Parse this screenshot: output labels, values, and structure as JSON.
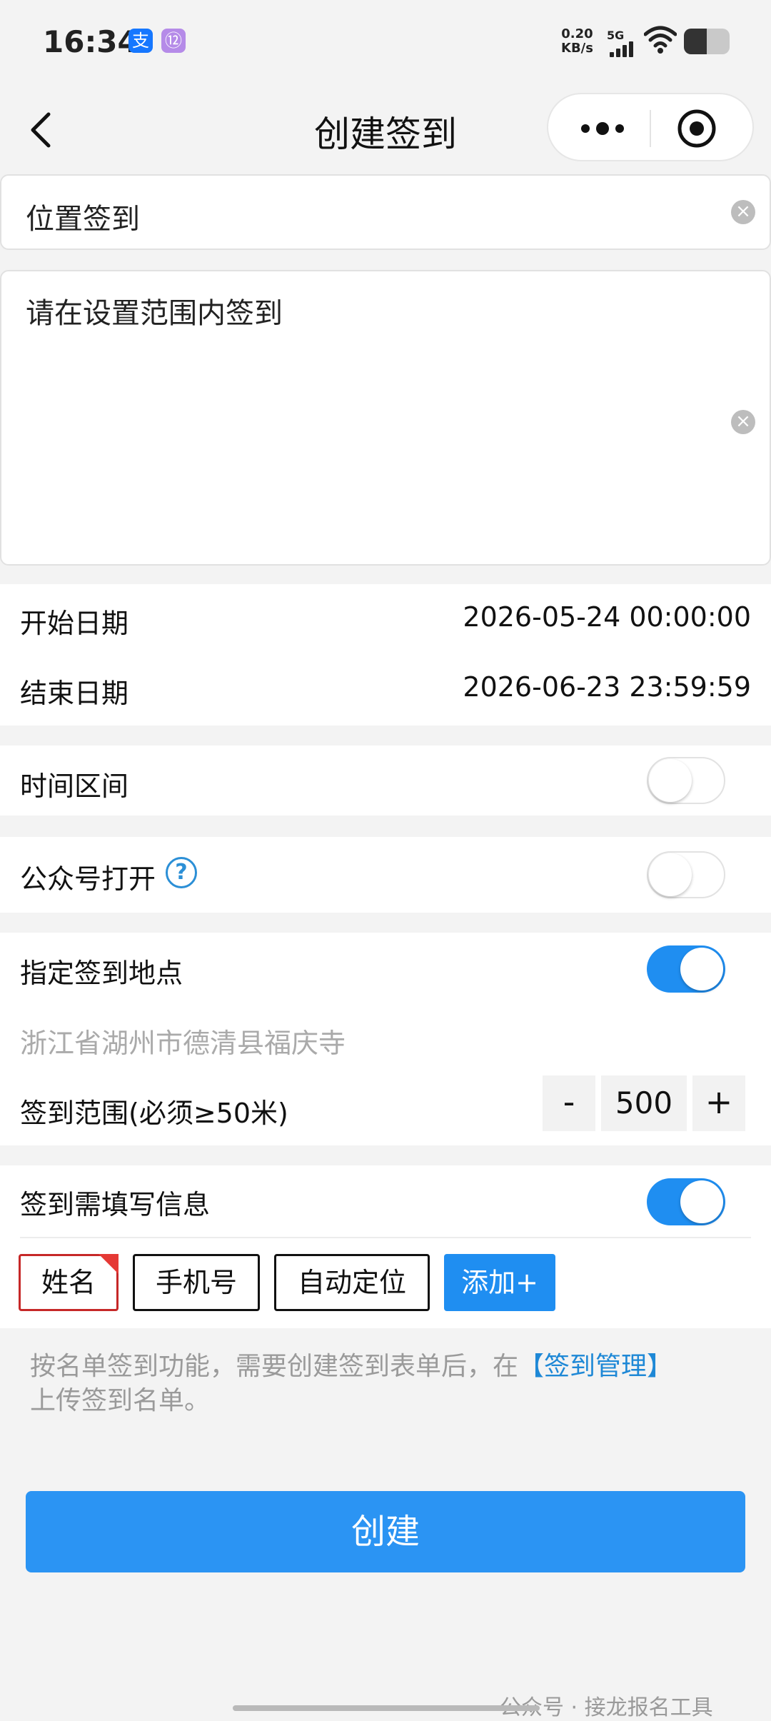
{
  "status_bar": {
    "time": "16:34",
    "net_speed_value": "0.20",
    "net_speed_unit": "KB/s",
    "network_type": "5G",
    "app_badges": [
      "支",
      "⑫"
    ]
  },
  "nav": {
    "title": "创建签到"
  },
  "form": {
    "title_value": "位置签到",
    "description_value": "请在设置范围内签到",
    "start_date_label": "开始日期",
    "start_date_value": "2026-05-24 00:00:00",
    "end_date_label": "结束日期",
    "end_date_value": "2026-06-23 23:59:59",
    "time_range_label": "时间区间",
    "time_range_on": false,
    "official_account_label": "公众号打开",
    "official_account_on": false,
    "location_label": "指定签到地点",
    "location_on": true,
    "address": "浙江省湖州市德清县福庆寺",
    "range_label": "签到范围(必须≥50米)",
    "range_minus": "-",
    "range_value": "500",
    "range_plus": "+",
    "require_info_label": "签到需填写信息",
    "require_info_on": true,
    "info_fields": [
      "姓名",
      "手机号",
      "自动定位"
    ],
    "add_field_label": "添加+"
  },
  "note": {
    "text_before": "按名单签到功能，需要创建签到表单后，在",
    "link_text": "【签到管理】",
    "text_after": "上传签到名单。"
  },
  "create_button_label": "创建",
  "watermark": "公众号 · 接龙报名工具",
  "colors": {
    "accent": "#1f8ef1",
    "link": "#1e88d6",
    "selected_chip_border": "#c62828"
  },
  "icons": [
    "back-arrow-icon",
    "more-dots-icon",
    "target-icon",
    "clear-icon",
    "help-icon",
    "wechat-icon"
  ]
}
